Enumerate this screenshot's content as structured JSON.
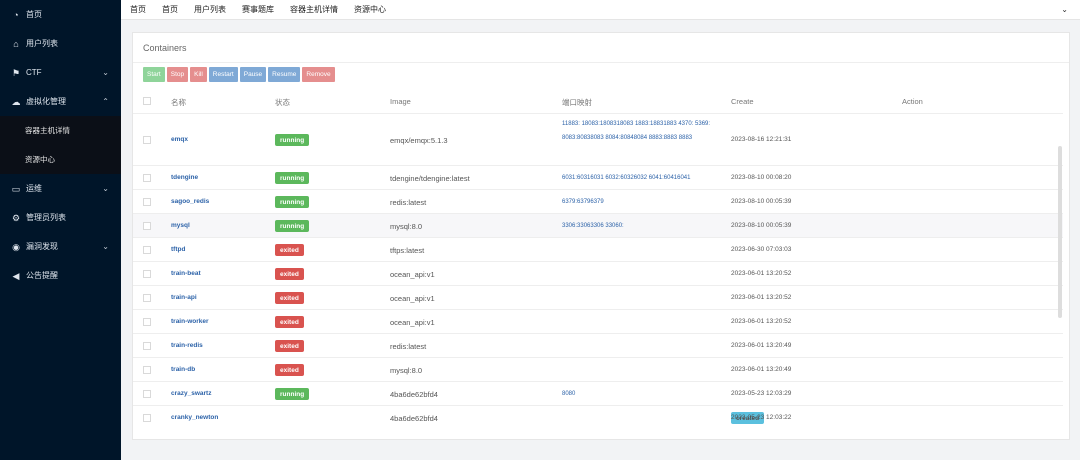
{
  "sidebar": {
    "items": [
      {
        "label": "首页",
        "icon": "dashboard-icon"
      },
      {
        "label": "用户列表",
        "icon": "home-icon"
      },
      {
        "label": "CTF",
        "icon": "flag-icon"
      },
      {
        "label": "虚拟化管理",
        "icon": "cloud-icon"
      },
      {
        "label": "容器主机详情",
        "sub": true
      },
      {
        "label": "资源中心",
        "sub": true
      },
      {
        "label": "运维",
        "icon": "monitor-icon"
      },
      {
        "label": "管理员列表",
        "icon": "gear-icon"
      },
      {
        "label": "漏洞发现",
        "icon": "globe-icon"
      },
      {
        "label": "公告提醒",
        "icon": "megaphone-icon"
      }
    ]
  },
  "topbar": {
    "tabs": [
      "首页",
      "首页",
      "用户列表",
      "赛事题库",
      "容器主机详情",
      "资源中心"
    ]
  },
  "panel": {
    "title": "Containers",
    "buttons": [
      "Start",
      "Stop",
      "Kill",
      "Restart",
      "Pause",
      "Resume",
      "Remove"
    ]
  },
  "table": {
    "headers": [
      "名称",
      "状态",
      "Image",
      "端口映射",
      "Create",
      "Action"
    ],
    "rows": [
      {
        "name": "emqx",
        "status": "running",
        "image": "emqx/emqx:5.1.3",
        "ports": "11883: 18083:1808318083 1883:18831883 4370: 5369: 8083:80838083 8084:80848084 8883:8883 8883",
        "created": "2023-08-16 12:21:31"
      },
      {
        "name": "tdengine",
        "status": "running",
        "image": "tdengine/tdengine:latest",
        "ports": "6031:60316031 6032:60326032 6041:60416041",
        "created": "2023-08-10 00:08:20"
      },
      {
        "name": "sagoo_redis",
        "status": "running",
        "image": "redis:latest",
        "ports": "6379:63796379",
        "created": "2023-08-10 00:05:39"
      },
      {
        "name": "mysql",
        "status": "running",
        "image": "mysql:8.0",
        "ports": "3306:33063306 33060:",
        "created": "2023-08-10 00:05:39"
      },
      {
        "name": "tftpd",
        "status": "exited",
        "image": "tftps:latest",
        "ports": "",
        "created": "2023-06-30 07:03:03"
      },
      {
        "name": "train-beat",
        "status": "exited",
        "image": "ocean_api:v1",
        "ports": "",
        "created": "2023-06-01 13:20:52"
      },
      {
        "name": "train-api",
        "status": "exited",
        "image": "ocean_api:v1",
        "ports": "",
        "created": "2023-06-01 13:20:52"
      },
      {
        "name": "train-worker",
        "status": "exited",
        "image": "ocean_api:v1",
        "ports": "",
        "created": "2023-06-01 13:20:52"
      },
      {
        "name": "train-redis",
        "status": "exited",
        "image": "redis:latest",
        "ports": "",
        "created": "2023-06-01 13:20:49"
      },
      {
        "name": "train-db",
        "status": "exited",
        "image": "mysql:8.0",
        "ports": "",
        "created": "2023-06-01 13:20:49"
      },
      {
        "name": "crazy_swartz",
        "status": "running",
        "image": "4ba6de62bfd4",
        "ports": "8080",
        "created": "2023-05-23 12:03:29"
      },
      {
        "name": "cranky_newton",
        "status": "created",
        "image": "4ba6de62bfd4",
        "ports": "",
        "created": "2023-05-23 12:03:22"
      }
    ]
  },
  "colors": {
    "sidebar_bg": "#001529",
    "running": "#5cb85c",
    "exited": "#d9534f",
    "created": "#5bc0de"
  }
}
